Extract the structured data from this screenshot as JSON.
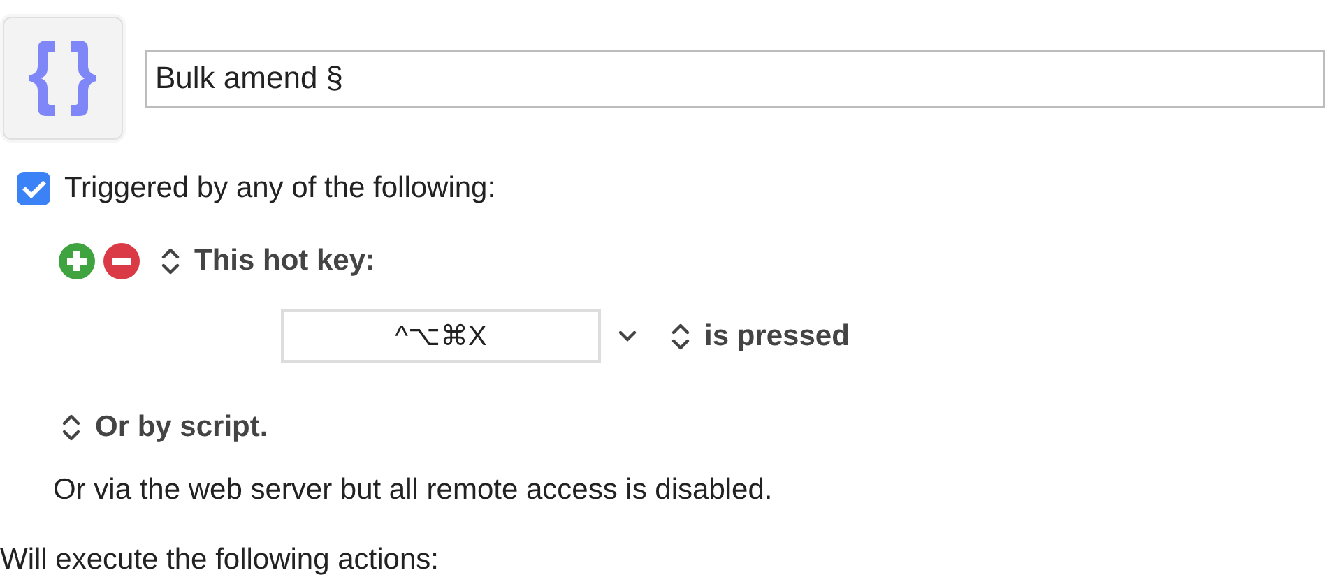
{
  "macro": {
    "name": "Bulk amend §"
  },
  "trigger_group": {
    "label": "Triggered by any of the following:",
    "checked": true
  },
  "hotkey_trigger": {
    "label": "This hot key:",
    "keys": "^⌥⌘X",
    "condition": "is pressed"
  },
  "script_trigger": {
    "label": "Or by script."
  },
  "web_note": "Or via the web server but all remote access is disabled.",
  "actions_heading": "Will execute the following actions:"
}
